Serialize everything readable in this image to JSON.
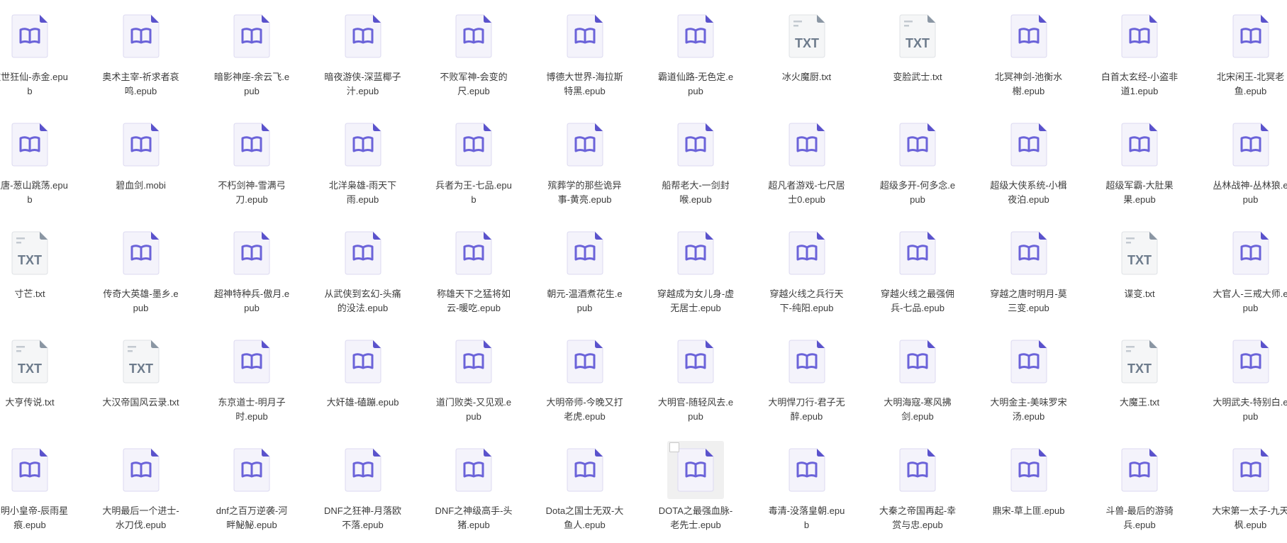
{
  "files": [
    {
      "name": "傲世狂仙-赤金.epub",
      "type": "epub"
    },
    {
      "name": "奥术主宰-祈求者哀鸣.epub",
      "type": "epub"
    },
    {
      "name": "暗影神座-余云飞.epub",
      "type": "epub"
    },
    {
      "name": "暗夜游侠-深蓝椰子汁.epub",
      "type": "epub"
    },
    {
      "name": "不败军神-会变的尺.epub",
      "type": "epub"
    },
    {
      "name": "博德大世界-海拉斯特黑.epub",
      "type": "epub"
    },
    {
      "name": "霸道仙路-无色定.epub",
      "type": "epub"
    },
    {
      "name": "冰火魔厨.txt",
      "type": "txt"
    },
    {
      "name": "变脸武士.txt",
      "type": "txt"
    },
    {
      "name": "北冥神剑-池衡水榭.epub",
      "type": "epub"
    },
    {
      "name": "白首太玄经-小盗非道1.epub",
      "type": "epub"
    },
    {
      "name": "北宋闲王-北冥老鱼.epub",
      "type": "epub"
    },
    {
      "name": "边唐-葱山跳荡.epub",
      "type": "epub"
    },
    {
      "name": "碧血剑.mobi",
      "type": "epub"
    },
    {
      "name": "不朽剑神-雪满弓刀.epub",
      "type": "epub"
    },
    {
      "name": "北洋枭雄-雨天下雨.epub",
      "type": "epub"
    },
    {
      "name": "兵者为王-七品.epub",
      "type": "epub"
    },
    {
      "name": "殡葬学的那些诡异事-黄亮.epub",
      "type": "epub"
    },
    {
      "name": "船帮老大-一剑封喉.epub",
      "type": "epub"
    },
    {
      "name": "超凡者游戏-七尺居士0.epub",
      "type": "epub"
    },
    {
      "name": "超级多开-何多念.epub",
      "type": "epub"
    },
    {
      "name": "超级大侠系统-小楫夜泊.epub",
      "type": "epub"
    },
    {
      "name": "超级军霸-大肚果果.epub",
      "type": "epub"
    },
    {
      "name": "丛林战神-丛林狼.epub",
      "type": "epub"
    },
    {
      "name": "寸芒.txt",
      "type": "txt"
    },
    {
      "name": "传奇大英雄-墨乡.epub",
      "type": "epub"
    },
    {
      "name": "超神特种兵-傲月.epub",
      "type": "epub"
    },
    {
      "name": "从武侠到玄幻-头痛的没法.epub",
      "type": "epub"
    },
    {
      "name": "称雄天下之猛将如云-暖吃.epub",
      "type": "epub"
    },
    {
      "name": "朝元-温酒煮花生.epub",
      "type": "epub"
    },
    {
      "name": "穿越成为女儿身-虚无居士.epub",
      "type": "epub"
    },
    {
      "name": "穿越火线之兵行天下-纯阳.epub",
      "type": "epub"
    },
    {
      "name": "穿越火线之最强佣兵-七品.epub",
      "type": "epub"
    },
    {
      "name": "穿越之唐时明月-莫三变.epub",
      "type": "epub"
    },
    {
      "name": "谍变.txt",
      "type": "txt"
    },
    {
      "name": "大官人-三戒大师.epub",
      "type": "epub"
    },
    {
      "name": "大亨传说.txt",
      "type": "txt"
    },
    {
      "name": "大汉帝国风云录.txt",
      "type": "txt"
    },
    {
      "name": "东京道士-明月子时.epub",
      "type": "epub"
    },
    {
      "name": "大奸雄-磕蹦.epub",
      "type": "epub"
    },
    {
      "name": "道门败类-又见观.epub",
      "type": "epub"
    },
    {
      "name": "大明帝师-今晚又打老虎.epub",
      "type": "epub"
    },
    {
      "name": "大明官-随轻风去.epub",
      "type": "epub"
    },
    {
      "name": "大明悍刀行-君子无醉.epub",
      "type": "epub"
    },
    {
      "name": "大明海寇-寒风拂剑.epub",
      "type": "epub"
    },
    {
      "name": "大明金主-美味罗宋汤.epub",
      "type": "epub"
    },
    {
      "name": "大魔王.txt",
      "type": "txt"
    },
    {
      "name": "大明武夫-特别白.epub",
      "type": "epub"
    },
    {
      "name": "大明小皇帝-辰雨星痕.epub",
      "type": "epub"
    },
    {
      "name": "大明最后一个进士-水刀伐.epub",
      "type": "epub"
    },
    {
      "name": "dnf之百万逆袭-河畔鮅鮅.epub",
      "type": "epub"
    },
    {
      "name": "DNF之狂神-月落欧不落.epub",
      "type": "epub"
    },
    {
      "name": "DNF之神级高手-头猪.epub",
      "type": "epub"
    },
    {
      "name": "Dota之国士无双-大鱼人.epub",
      "type": "epub"
    },
    {
      "name": "DOTA之最强血脉-老先士.epub",
      "type": "epub",
      "selected": true
    },
    {
      "name": "毒清-没落皇朝.epub",
      "type": "epub"
    },
    {
      "name": "大秦之帝国再起-幸赏与忠.epub",
      "type": "epub"
    },
    {
      "name": "鼎宋-草上匪.epub",
      "type": "epub"
    },
    {
      "name": "斗兽-最后的游骑兵.epub",
      "type": "epub"
    },
    {
      "name": "大宋第一太子-九天枫.epub",
      "type": "epub"
    }
  ],
  "icons": {
    "epub": "book-file-icon",
    "txt": "txt-file-icon",
    "txt_badge": "TXT"
  },
  "colors": {
    "epub_accent": "#6b63d9",
    "epub_page": "#f4f3fb",
    "txt_text": "#6d7b8c",
    "txt_page": "#f5f6f7",
    "fold": "#5a52cc"
  }
}
